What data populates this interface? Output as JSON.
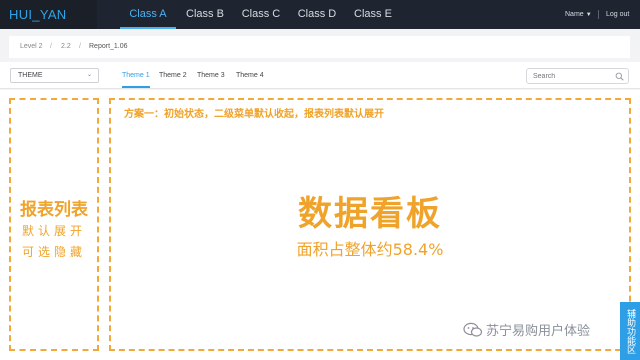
{
  "app": {
    "logo": "HUI_YAN"
  },
  "nav": {
    "tabs": [
      "Class A",
      "Class B",
      "Class C",
      "Class D",
      "Class E"
    ],
    "active_tab": "Class A",
    "user_label": "Name",
    "logout_label": "Log out"
  },
  "breadcrumb": [
    "Level 2",
    "2.2",
    "Report_1.06"
  ],
  "toolbar": {
    "theme_select_value": "THEME",
    "theme_tabs": [
      "Theme 1",
      "Theme 2",
      "Theme 3",
      "Theme 4"
    ],
    "active_theme": "Theme 1",
    "search_placeholder": "Search"
  },
  "left_panel": {
    "title": "报表列表",
    "line1": "默认展开",
    "line2": "可选隐藏"
  },
  "main_panel": {
    "note": "方案一：初始状态，二级菜单默认收起，报表列表默认展开",
    "title": "数据看板",
    "subtitle": "面积占整体约58.4%"
  },
  "watermark": "苏宁易购用户体验",
  "aux_tab": "辅助功能区",
  "colors": {
    "accent": "#2e9fe6",
    "highlight": "#f0a32a",
    "nav_bg": "#1f2530"
  },
  "icons": {
    "search": "search-icon",
    "wechat": "wechat-icon",
    "caret": "chevron-down-icon"
  }
}
